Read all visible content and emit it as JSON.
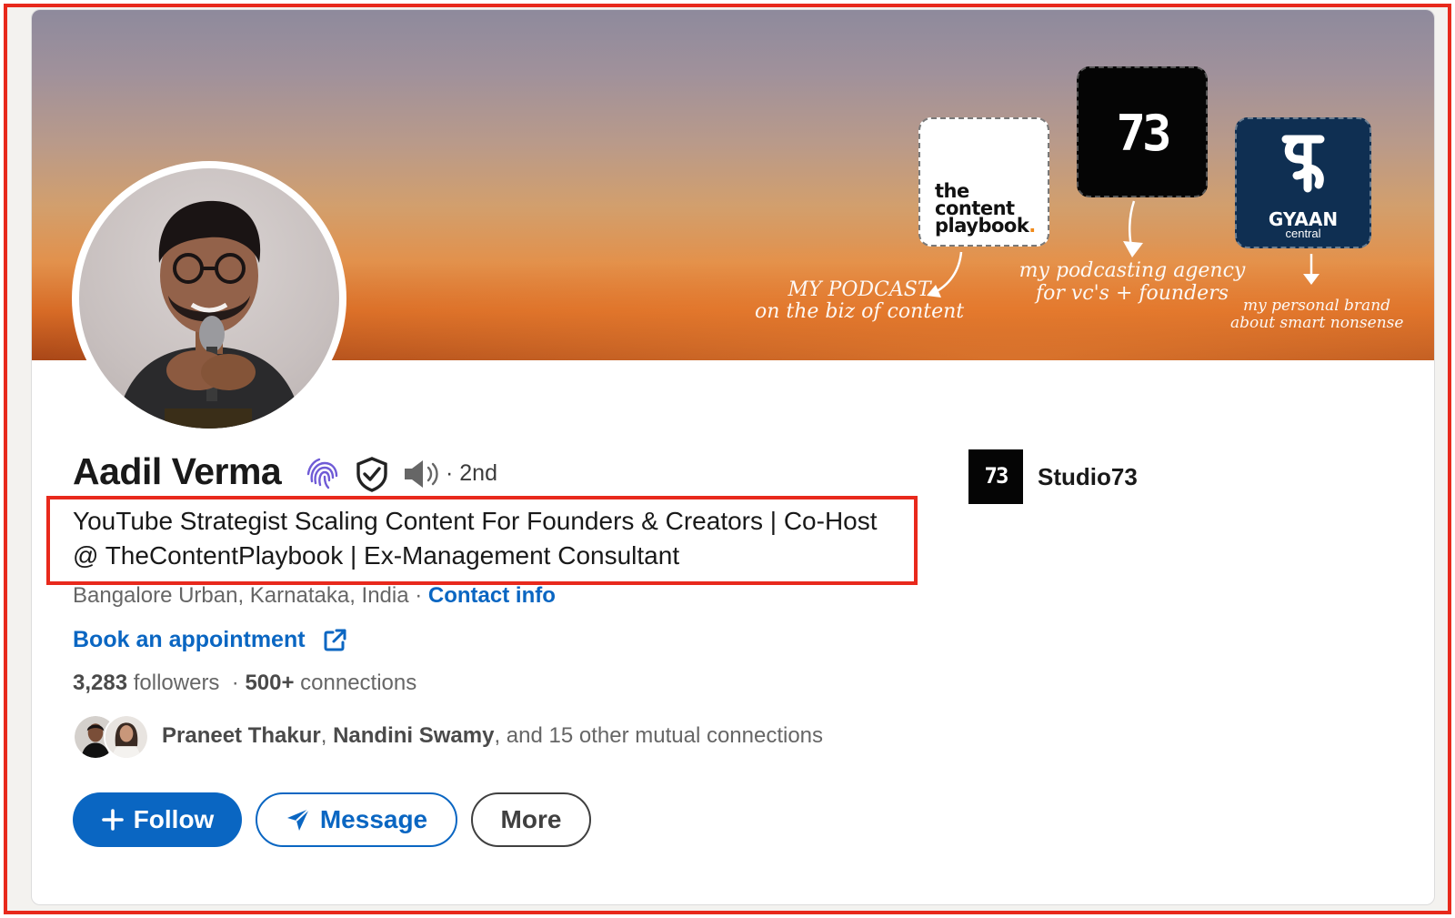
{
  "banner": {
    "tiles": {
      "playbook_line1": "the",
      "playbook_line2": "content",
      "playbook_line3": "playbook",
      "playbook_dot": ".",
      "studio_number": "73",
      "gyaan_name": "GYAAN",
      "gyaan_sub": "central"
    },
    "notes": {
      "podcast_line1": "MY PODCAST",
      "podcast_line2": "on the biz of content",
      "agency_line1": "my podcasting agency",
      "agency_line2": "for vc's + founders",
      "brand_line1": "my personal brand",
      "brand_line2": "about smart nonsense"
    }
  },
  "profile": {
    "name": "Aadil Verma",
    "degree": "· 2nd",
    "headline": "YouTube Strategist Scaling Content For Founders & Creators | Co-Host @ TheContentPlaybook | Ex-Management Consultant",
    "location": "Bangalore Urban, Karnataka, India",
    "location_sep": " · ",
    "contact_info": "Contact info",
    "book_appointment": "Book an appointment",
    "followers_count": "3,283",
    "followers_label": " followers",
    "stats_sep": "  · ",
    "connections_count": "500+",
    "connections_label": " connections",
    "mutual": {
      "name1": "Praneet Thakur",
      "sep": ", ",
      "name2": "Nandini Swamy",
      "rest": ", and 15 other mutual connections"
    }
  },
  "actions": {
    "follow": "Follow",
    "message": "Message",
    "more": "More"
  },
  "company": {
    "logo_text": "73",
    "name": "Studio73"
  },
  "colors": {
    "accent": "#0a66c2",
    "highlight": "#e8291c"
  },
  "icons": [
    "verified-fingerprint-icon",
    "shield-check-icon",
    "speaker-icon",
    "external-link-icon",
    "plus-icon",
    "send-icon"
  ]
}
